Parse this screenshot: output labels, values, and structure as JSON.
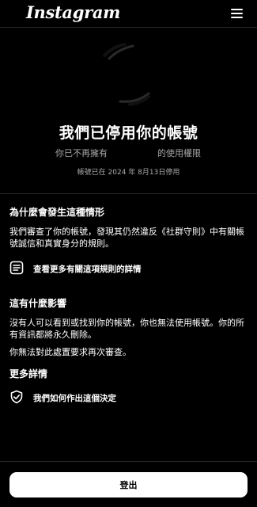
{
  "header": {
    "logo_text": "Instagram",
    "menu_icon": "hamburger-menu-icon"
  },
  "hero": {
    "avatar_icon": "avatar-ring-icon",
    "title": "我們已停用你的帳號",
    "subtitle_left": "你已不再擁有",
    "subtitle_right": "的使用權限",
    "disabled_date": "帳號已在 2024 年 8月13日停用"
  },
  "why_section": {
    "heading": "為什麼會發生這種情形",
    "body": "我們審查了你的帳號，發現其仍然違反《社群守則》中有關帳號誠信和真實身分的規則。",
    "link_icon": "document-icon",
    "link_label": "查看更多有關這項規則的詳情"
  },
  "impact_section": {
    "heading": "這有什麼影響",
    "body1": "沒有人可以看到或找到你的帳號，你也無法使用帳號。你的所有資訊都將永久刪除。",
    "body2": "你無法對此處置要求再次審查。"
  },
  "details_section": {
    "heading": "更多詳情",
    "link_icon": "shield-check-icon",
    "link_label": "我們如何作出這個決定"
  },
  "footer": {
    "logout_label": "登出"
  }
}
